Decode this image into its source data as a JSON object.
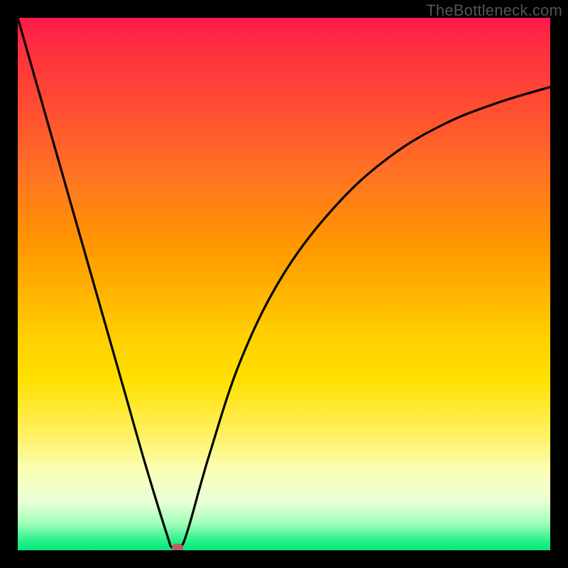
{
  "watermark": "TheBottleneck.com",
  "chart_data": {
    "type": "line",
    "title": "",
    "xlabel": "",
    "ylabel": "",
    "xlim": [
      0,
      100
    ],
    "ylim": [
      0,
      100
    ],
    "legend": false,
    "grid": false,
    "background_gradient_stops": [
      {
        "pos": 0,
        "color": "#ff1a4a"
      },
      {
        "pos": 18,
        "color": "#ff5030"
      },
      {
        "pos": 42,
        "color": "#ff9500"
      },
      {
        "pos": 60,
        "color": "#ffd000"
      },
      {
        "pos": 78,
        "color": "#fff060"
      },
      {
        "pos": 95,
        "color": "#a0ffb8"
      },
      {
        "pos": 100,
        "color": "#00e878"
      }
    ],
    "series": [
      {
        "name": "bottleneck-curve",
        "color": "#000000",
        "x": [
          0,
          4,
          8,
          12,
          16,
          20,
          24,
          28,
          29,
          30.5,
          32,
          36,
          42,
          50,
          60,
          70,
          80,
          90,
          100
        ],
        "y": [
          100,
          86,
          72,
          58,
          44,
          30,
          16,
          3,
          0.5,
          0.5,
          4,
          18,
          36,
          52,
          65,
          74,
          80,
          84,
          87
        ]
      }
    ],
    "marker": {
      "name": "optimum-marker",
      "x": 30,
      "y": 0.5,
      "color": "#b86060",
      "shape": "capsule"
    }
  }
}
